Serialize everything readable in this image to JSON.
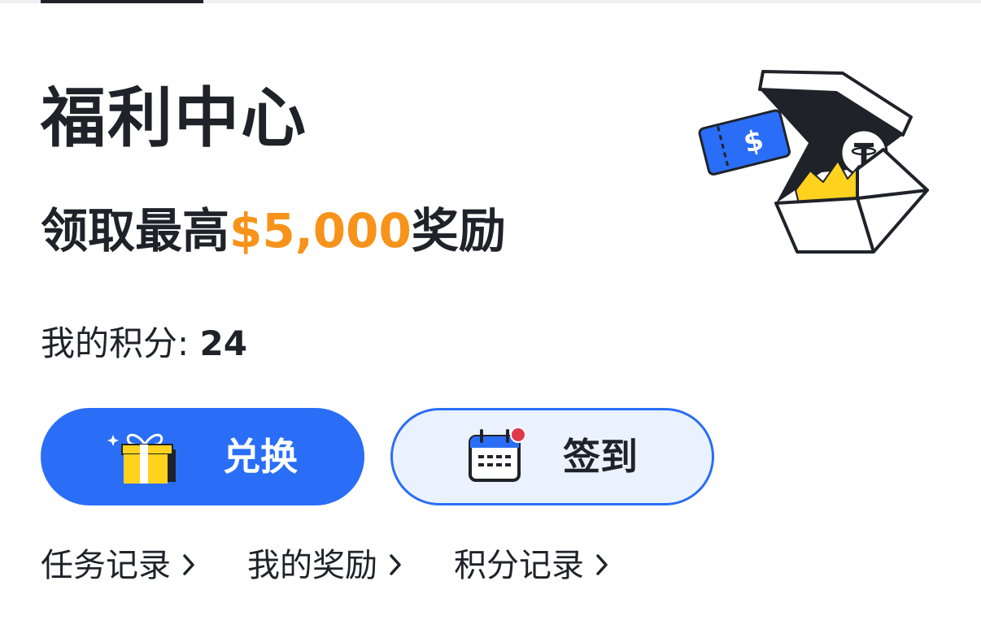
{
  "header": {
    "title": "福利中心",
    "subtitle_prefix": "领取最高",
    "subtitle_amount": "$5,000",
    "subtitle_suffix": "奖励"
  },
  "points": {
    "label": "我的积分:",
    "value": "24"
  },
  "actions": {
    "redeem_label": "兑换",
    "checkin_label": "签到"
  },
  "links": [
    {
      "label": "任务记录"
    },
    {
      "label": "我的奖励"
    },
    {
      "label": "积分记录"
    }
  ],
  "hero": {
    "ticket_symbol": "$",
    "coin_symbol": "T"
  },
  "colors": {
    "accent": "#2a6ef7",
    "amount": "#f7931a",
    "text": "#1f2329",
    "gift_yellow": "#ffd21e",
    "notification_dot": "#e0394b",
    "checkin_bg": "#ebf2ff"
  },
  "icons": {
    "hero": "treasure-box-illustration",
    "redeem": "gift-icon",
    "checkin": "calendar-icon",
    "link_arrow": "chevron-right-icon"
  }
}
